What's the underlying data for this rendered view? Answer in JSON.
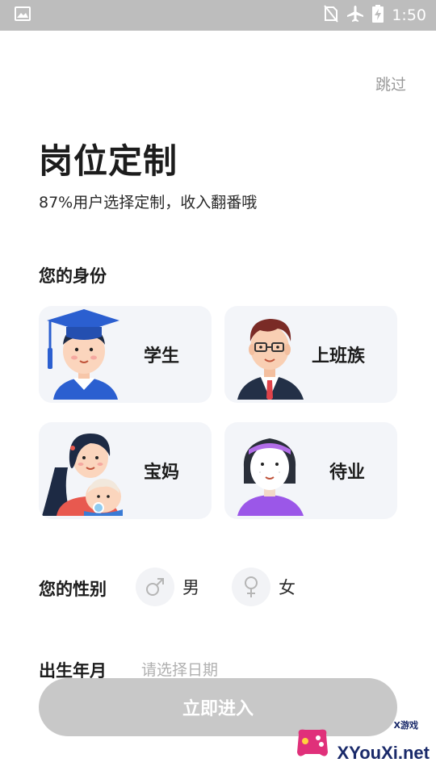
{
  "status_bar": {
    "time": "1:50"
  },
  "header": {
    "skip_label": "跳过"
  },
  "page": {
    "title": "岗位定制",
    "subtitle": "87%用户选择定制，收入翻番哦"
  },
  "identity": {
    "section_label": "您的身份",
    "options": [
      {
        "label": "学生"
      },
      {
        "label": "上班族"
      },
      {
        "label": "宝妈"
      },
      {
        "label": "待业"
      }
    ]
  },
  "gender": {
    "section_label": "您的性别",
    "male_label": "男",
    "female_label": "女"
  },
  "birth": {
    "section_label": "出生年月",
    "placeholder": "请选择日期"
  },
  "submit_label": "立即进入",
  "watermark": {
    "small": "X游戏",
    "brand": "XYouXi.net"
  }
}
